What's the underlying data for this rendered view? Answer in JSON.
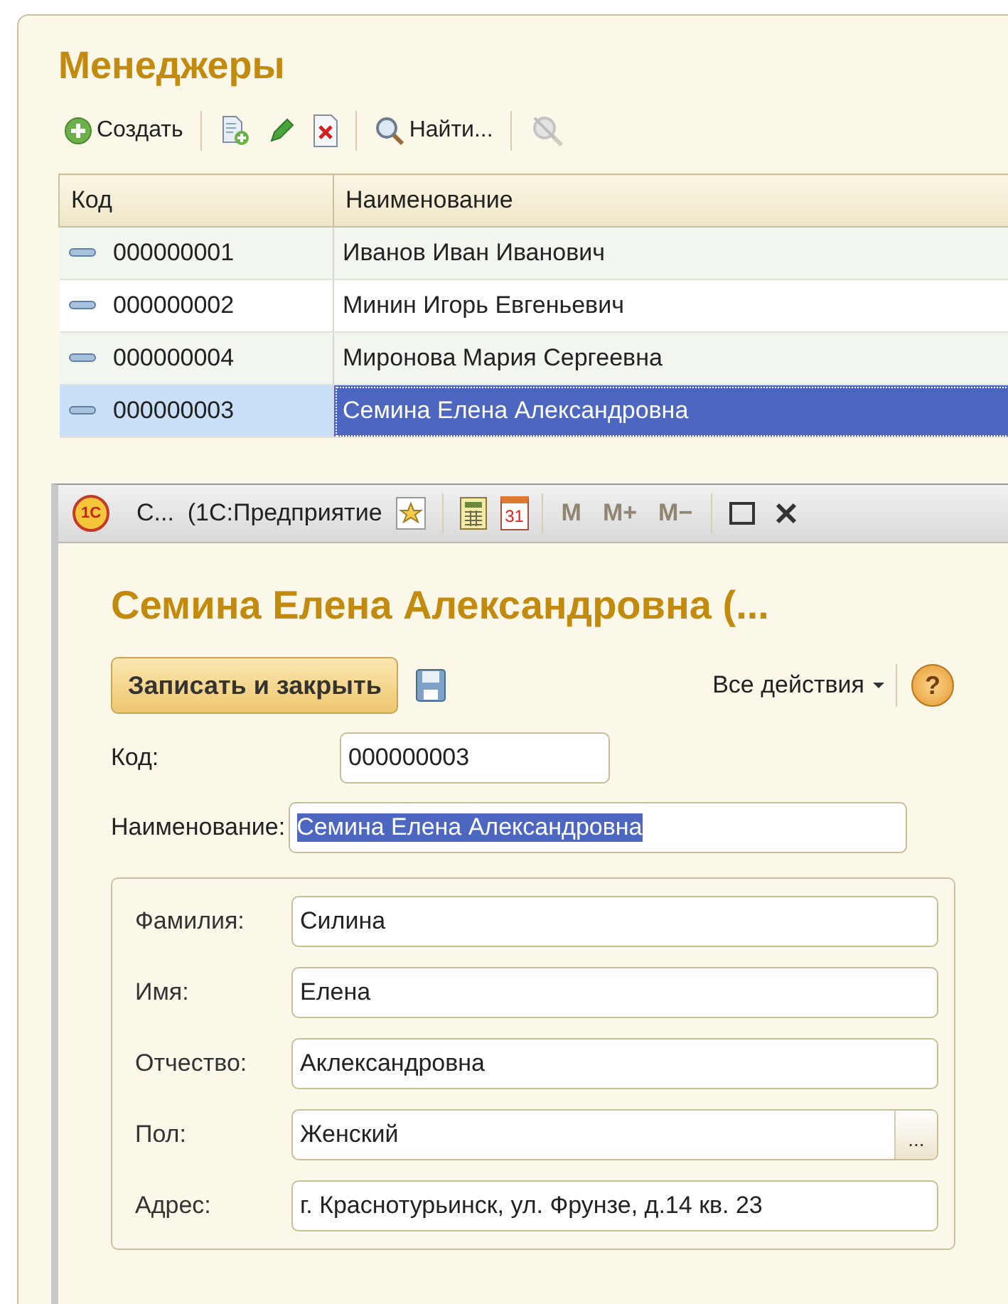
{
  "list_window": {
    "title": "Менеджеры",
    "toolbar": [
      {
        "kind": "button",
        "label": "Создать",
        "disabled": false
      },
      {
        "kind": "separator"
      },
      {
        "kind": "icon",
        "disabled": false
      },
      {
        "kind": "icon",
        "disabled": false
      },
      {
        "kind": "icon",
        "disabled": false
      },
      {
        "kind": "separator"
      },
      {
        "kind": "button",
        "label": "Найти...",
        "disabled": false
      },
      {
        "kind": "separator"
      },
      {
        "kind": "icon",
        "disabled": true
      }
    ],
    "table": {
      "columns": [
        "Код",
        "Наименование"
      ],
      "rows": [
        {
          "code": "000000001",
          "name": "Иванов Иван Иванович",
          "selected": false
        },
        {
          "code": "000000002",
          "name": "Минин Игорь Евгеньевич",
          "selected": false
        },
        {
          "code": "000000004",
          "name": "Миронова Мария Сергеевна",
          "selected": false
        },
        {
          "code": "000000003",
          "name": "Семина Елена Александровна",
          "selected": true
        }
      ]
    }
  },
  "form_window": {
    "logo": "1С",
    "title": "С...  (1С:Предприятие",
    "tools": [
      {
        "kind": "icon",
        "disabled": false
      },
      {
        "kind": "separator"
      },
      {
        "kind": "icon",
        "disabled": false
      },
      {
        "kind": "calendar",
        "label": "31",
        "disabled": false
      },
      {
        "kind": "separator"
      },
      {
        "kind": "text",
        "label": "M",
        "disabled": true
      },
      {
        "kind": "text",
        "label": "M+",
        "disabled": true
      },
      {
        "kind": "text",
        "label": "M−",
        "disabled": true
      },
      {
        "kind": "separator"
      },
      {
        "kind": "icon",
        "disabled": false
      },
      {
        "kind": "icon",
        "disabled": false
      }
    ],
    "heading": "Семина Елена Александровна (...",
    "save_close_button": "Записать и закрыть",
    "all_actions": "Все действия",
    "help": "?",
    "fields": [
      {
        "label": "Код:",
        "value": "000000003",
        "highlighted": false,
        "kind": "short"
      },
      {
        "label": "Наименование:",
        "value": "Семина Елена Александровна",
        "highlighted": true,
        "kind": "wide"
      }
    ],
    "group_fields": [
      {
        "label": "Фамилия:",
        "value": "Силина",
        "kind": "text"
      },
      {
        "label": "Имя:",
        "value": "Елена",
        "kind": "text"
      },
      {
        "label": "Отчество:",
        "value": "Аклександровна",
        "kind": "text"
      },
      {
        "label": "Пол:",
        "value": "Женский",
        "kind": "choice",
        "button": "..."
      },
      {
        "label": "Адрес:",
        "value": "г. Краснотурьинск, ул. Фрунзе, д.14 кв. 23",
        "kind": "text"
      }
    ]
  }
}
